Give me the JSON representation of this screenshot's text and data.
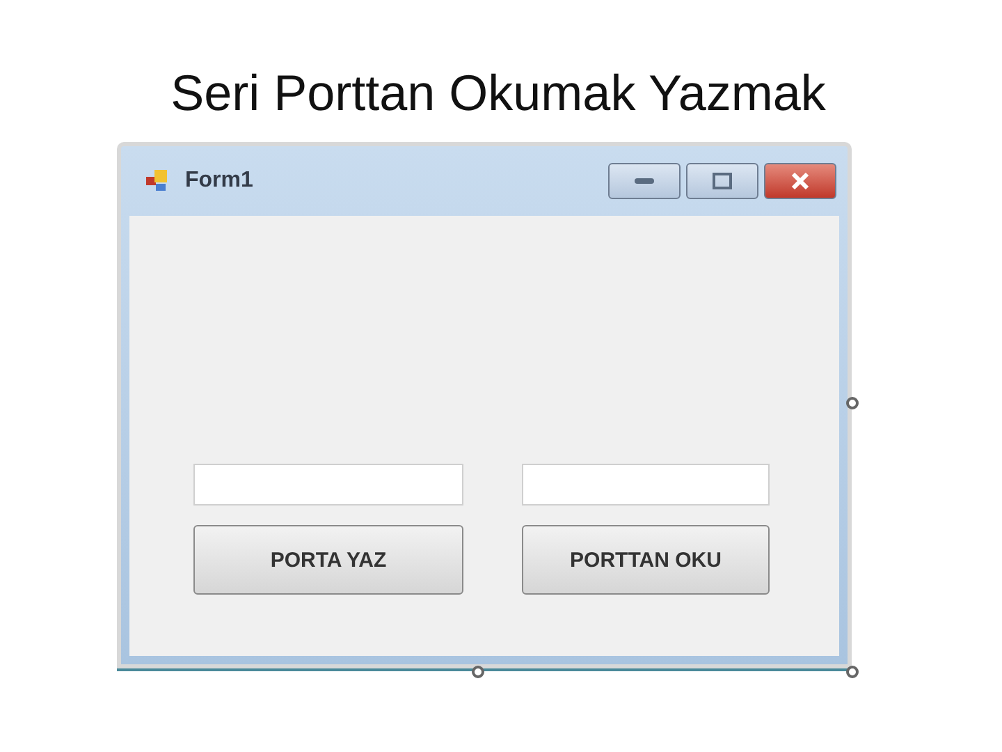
{
  "slide_title": "Seri Porttan Okumak Yazmak",
  "window": {
    "title": "Form1"
  },
  "controls": [
    {
      "kind": "textbox"
    },
    {
      "kind": "textbox"
    },
    {
      "kind": "button",
      "label": "PORTA YAZ"
    },
    {
      "kind": "button",
      "label": "PORTTAN OKU"
    }
  ]
}
